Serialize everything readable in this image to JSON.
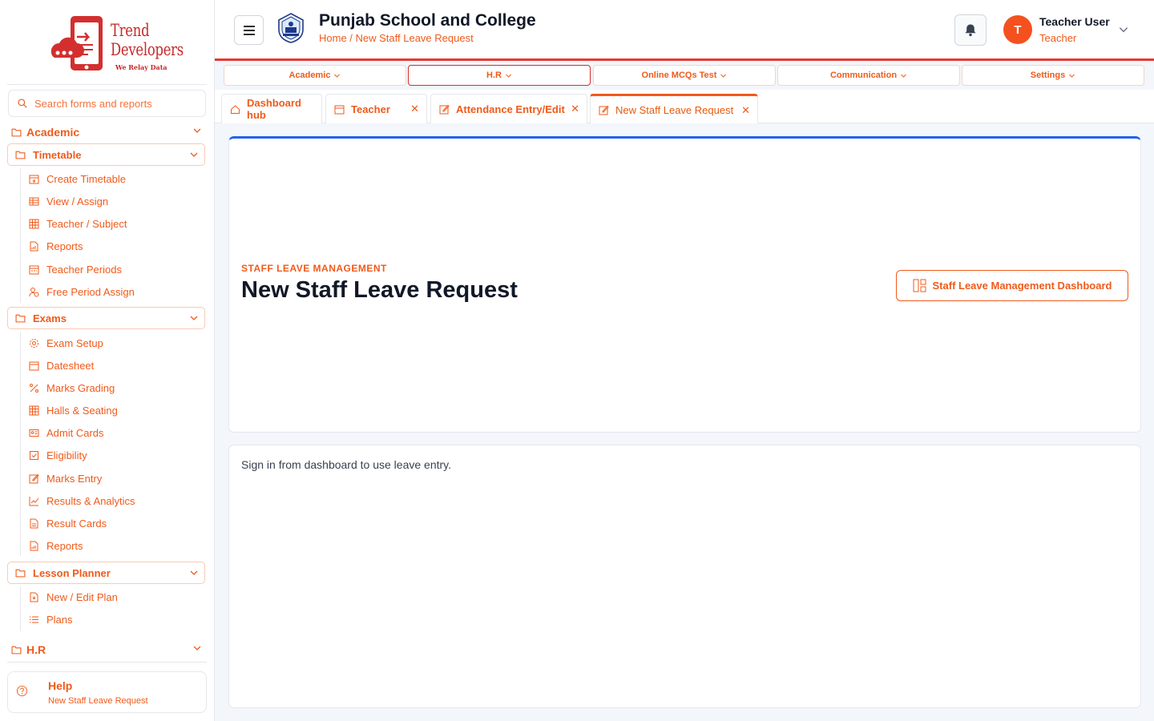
{
  "brand": {
    "logo_line1": "Trend",
    "logo_line2": "Developers",
    "tagline": "We Relay Data"
  },
  "sidebar": {
    "search_placeholder": "Search forms and reports",
    "sections": [
      {
        "label": "Academic",
        "groups": [
          {
            "label": "Timetable",
            "items": [
              {
                "label": "Create Timetable",
                "icon": "calendar-plus-icon"
              },
              {
                "label": "View / Assign",
                "icon": "table-icon"
              },
              {
                "label": "Teacher / Subject",
                "icon": "grid-icon"
              },
              {
                "label": "Reports",
                "icon": "report-icon"
              },
              {
                "label": "Teacher Periods",
                "icon": "calendar-icon"
              },
              {
                "label": "Free Period Assign",
                "icon": "user-clock-icon"
              }
            ]
          },
          {
            "label": "Exams",
            "items": [
              {
                "label": "Exam Setup",
                "icon": "gear-icon"
              },
              {
                "label": "Datesheet",
                "icon": "calendar-icon"
              },
              {
                "label": "Marks Grading",
                "icon": "percent-icon"
              },
              {
                "label": "Halls & Seating",
                "icon": "grid-icon"
              },
              {
                "label": "Admit Cards",
                "icon": "id-card-icon"
              },
              {
                "label": "Eligibility",
                "icon": "checkbox-icon"
              },
              {
                "label": "Marks Entry",
                "icon": "edit-icon"
              },
              {
                "label": "Results & Analytics",
                "icon": "chart-line-icon"
              },
              {
                "label": "Result Cards",
                "icon": "file-icon"
              },
              {
                "label": "Reports",
                "icon": "report-icon"
              }
            ]
          },
          {
            "label": "Lesson Planner",
            "items": [
              {
                "label": "New / Edit Plan",
                "icon": "file-plus-icon"
              },
              {
                "label": "Plans",
                "icon": "list-icon"
              }
            ]
          }
        ]
      },
      {
        "label": "H.R"
      }
    ],
    "help": {
      "title": "Help",
      "subtitle": "New Staff Leave Request"
    }
  },
  "header": {
    "school_name": "Punjab School and College",
    "breadcrumb": "Home / New Staff Leave Request",
    "user_initial": "T",
    "user_name": "Teacher User",
    "user_role": "Teacher"
  },
  "topnav": [
    {
      "label": "Academic",
      "active": false
    },
    {
      "label": "H.R",
      "active": true
    },
    {
      "label": "Online MCQs Test",
      "active": false
    },
    {
      "label": "Communication",
      "active": false
    },
    {
      "label": "Settings",
      "active": false
    }
  ],
  "tabs": [
    {
      "label": "Dashboard hub",
      "icon": "home-icon",
      "closable": false,
      "active": false
    },
    {
      "label": "Teacher",
      "icon": "calendar-icon",
      "closable": true,
      "active": false
    },
    {
      "label": "Attendance Entry/Edit",
      "icon": "edit-icon",
      "closable": true,
      "active": false
    },
    {
      "label": "New Staff Leave Request",
      "icon": "edit-icon",
      "closable": true,
      "active": true
    }
  ],
  "page": {
    "kicker": "STAFF LEAVE MANAGEMENT",
    "title": "New Staff Leave Request",
    "dashboard_button": "Staff Leave Management Dashboard",
    "message": "Sign in from dashboard to use leave entry."
  },
  "colors": {
    "accent": "#f05a1a",
    "header_rule": "#e53935",
    "hero_top_border": "#2563eb",
    "avatar": "#f4511e"
  }
}
